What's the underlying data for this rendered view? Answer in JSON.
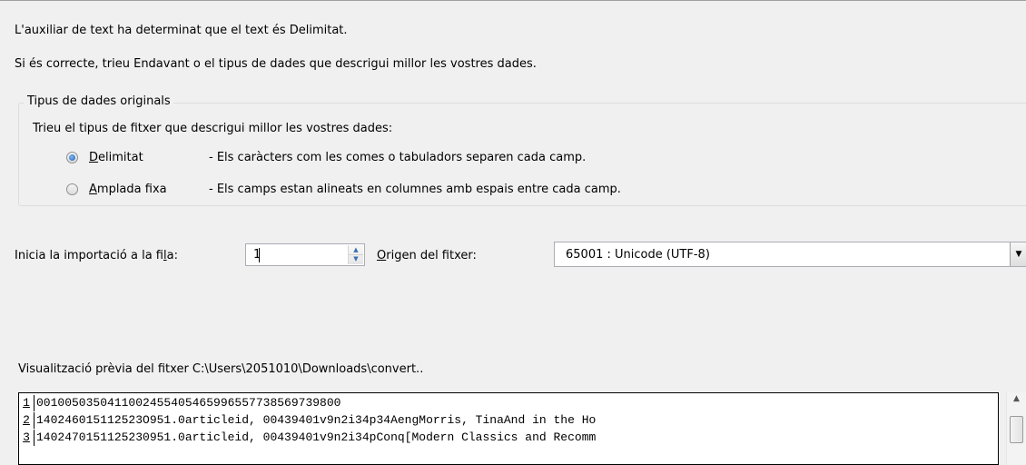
{
  "intro": {
    "line1": "L'auxiliar de text ha determinat que el text és Delimitat.",
    "line2": "Si és correcte, trieu Endavant o el tipus de dades que descrigui millor les vostres dades."
  },
  "group": {
    "legend": "Tipus de dades originals",
    "prompt": "Trieu el tipus de fitxer que descrigui millor les vostres dades:",
    "options": [
      {
        "hotkey": "D",
        "rest": "elimitat",
        "description": "- Els caràcters com les comes o tabuladors separen cada camp.",
        "selected": true
      },
      {
        "hotkey": "A",
        "rest": "mplada fixa",
        "description": "- Els camps estan alineats en columnes amb espais entre cada camp.",
        "selected": false
      }
    ]
  },
  "start": {
    "label_before": "Inicia la importació a la fi",
    "label_hotkey": "l",
    "label_after": "a:",
    "value": "1"
  },
  "origin": {
    "label_hotkey": "O",
    "label_rest": "rigen del fitxer:",
    "value": "65001 : Unicode (UTF-8)"
  },
  "preview": {
    "label": "Visualització prèvia del fitxer C:\\Users\\2051010\\Downloads\\convert..",
    "lines": [
      {
        "num": "1",
        "text": "0010050350411002455405465996557738569739800"
      },
      {
        "num": "2",
        "text": "140246015112523O951.0articleid, 00439401v9n2i34p34AengMorris, TinaAnd in the Ho"
      },
      {
        "num": "3",
        "text": "1402470151125230951.0articleid, 00439401v9n2i34pConq[Modern Classics and Recomm"
      }
    ]
  }
}
